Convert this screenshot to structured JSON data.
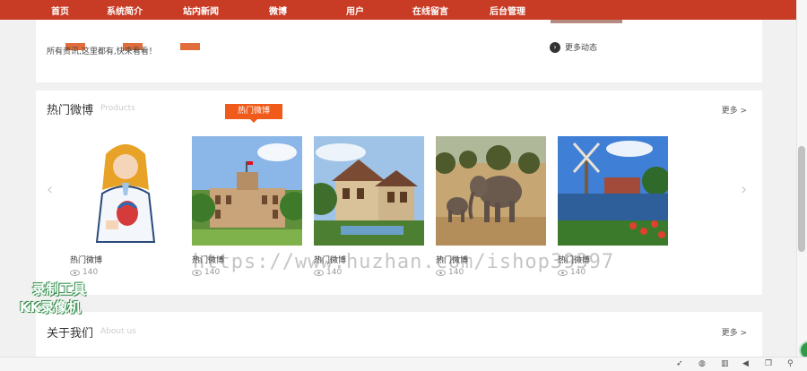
{
  "nav": {
    "items": [
      "首页",
      "系统简介",
      "站内新闻",
      "微博",
      "用户",
      "在线留言",
      "后台管理"
    ]
  },
  "top_panel": {
    "caption": "所有资讯,这里都有,快来看看！",
    "more_news_label": "更多动态",
    "more_news_icon": "chevron-right-circle-icon"
  },
  "hot": {
    "title": "热门微博",
    "subtitle": "Products",
    "more_label": "更多 >",
    "badge": "热门微博",
    "prev_arrow": "‹",
    "next_arrow": "›",
    "cards": [
      {
        "title": "热门微博",
        "views": "140",
        "image": "doctor-illustration"
      },
      {
        "title": "热门微博",
        "views": "140",
        "image": "historic-building-photo"
      },
      {
        "title": "热门微博",
        "views": "140",
        "image": "villa-photo"
      },
      {
        "title": "热门微博",
        "views": "140",
        "image": "elephants-photo"
      },
      {
        "title": "热门微博",
        "views": "140",
        "image": "windmill-photo"
      }
    ]
  },
  "about": {
    "title": "关于我们",
    "subtitle": "About us",
    "more_label": "更多 >"
  },
  "overlay": {
    "watermark": "https://www.huzhan.com/ishop39397",
    "recorder_line1": "录制工具",
    "recorder_line2": "KK录像机"
  },
  "tray": {
    "icons": [
      "rocket-icon",
      "globe-icon",
      "trash-icon",
      "speaker-icon",
      "window-icon",
      "search-icon"
    ]
  },
  "colors": {
    "nav_bg": "#c83b24",
    "badge_bg": "#f05a1a",
    "page_bg": "#f1f1f1"
  }
}
